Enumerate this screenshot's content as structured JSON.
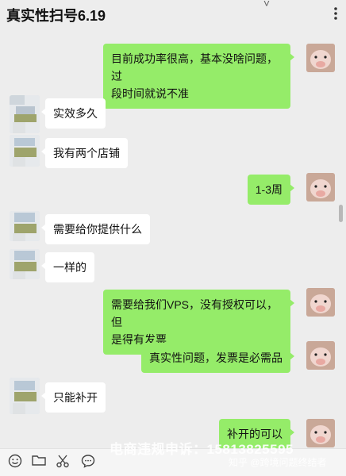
{
  "header": {
    "title": "真实性扫号6.19",
    "more_icon": "more-vertical-icon"
  },
  "messages": [
    {
      "sender": "me",
      "text_line1": "目前成功率很高，基本没啥问题，过",
      "text_line2": "段时间就说不准"
    },
    {
      "sender": "them",
      "text": "实效多久"
    },
    {
      "sender": "them",
      "text": "我有两个店铺"
    },
    {
      "sender": "me",
      "text": "1-3周"
    },
    {
      "sender": "them",
      "text": "需要给你提供什么"
    },
    {
      "sender": "them",
      "text": "一样的"
    },
    {
      "sender": "me",
      "text_line1": "需要给我们VPS，没有授权可以，但",
      "text_line2": "是得有发票"
    },
    {
      "sender": "me",
      "text": "真实性问题，发票是必需品"
    },
    {
      "sender": "them",
      "text": "只能补开"
    },
    {
      "sender": "me",
      "text": "补开的可以"
    }
  ],
  "toolbar": {
    "icons": [
      "emoji-icon",
      "folder-icon",
      "scissors-icon",
      "chat-bubble-icon"
    ]
  },
  "watermark": {
    "complaint_line": "电商违规申诉：15813825595",
    "zhihu_line": "知乎 @跨境问题终结者"
  },
  "colors": {
    "background": "#ededed",
    "my_bubble": "#95ec69",
    "their_bubble": "#ffffff"
  }
}
